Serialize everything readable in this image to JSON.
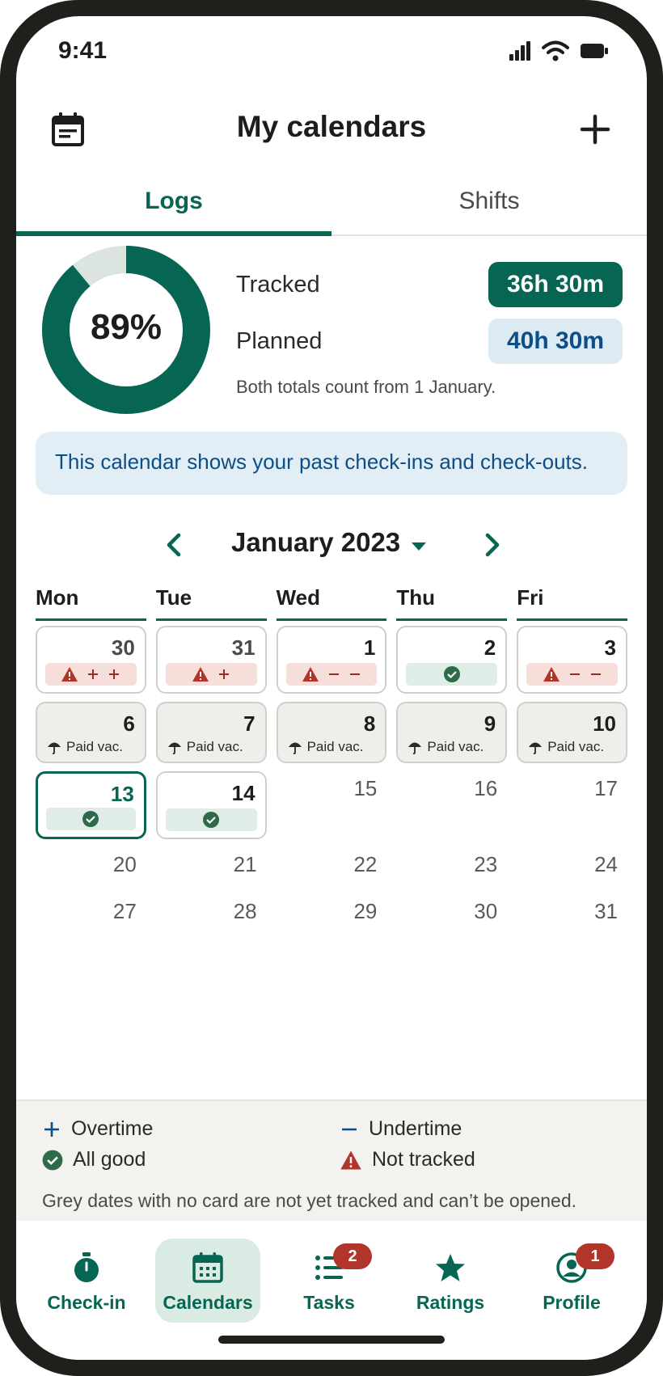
{
  "status": {
    "time": "9:41"
  },
  "header": {
    "title": "My calendars"
  },
  "tabs": [
    {
      "label": "Logs"
    },
    {
      "label": "Shifts"
    }
  ],
  "summary": {
    "percent": "89%",
    "percent_value": 0.89,
    "tracked_label": "Tracked",
    "tracked_value": "36h 30m",
    "planned_label": "Planned",
    "planned_value": "40h 30m",
    "note": "Both totals count from 1 January."
  },
  "info_banner": "This calendar shows your past check-ins and check-outs.",
  "month": {
    "label": "January 2023"
  },
  "weekdays": [
    "Mon",
    "Tue",
    "Wed",
    "Thu",
    "Fri"
  ],
  "days": {
    "d30a": "30",
    "d31a": "31",
    "d1": "1",
    "d2": "2",
    "d3": "3",
    "d6": "6",
    "d7": "7",
    "d8": "8",
    "d9": "9",
    "d10": "10",
    "d13": "13",
    "d14": "14",
    "d15": "15",
    "d16": "16",
    "d17": "17",
    "d20": "20",
    "d21": "21",
    "d22": "22",
    "d23": "23",
    "d24": "24",
    "d27": "27",
    "d28": "28",
    "d29": "29",
    "d30b": "30",
    "d31b": "31"
  },
  "vacation_label": "Paid vac.",
  "legend": {
    "overtime": "Overtime",
    "undertime": "Undertime",
    "all_good": "All good",
    "not_tracked": "Not tracked",
    "note": "Grey dates with no card are not yet tracked and can’t be opened."
  },
  "nav": {
    "checkin": "Check-in",
    "calendars": "Calendars",
    "tasks": "Tasks",
    "tasks_badge": "2",
    "ratings": "Ratings",
    "profile": "Profile",
    "profile_badge": "1"
  },
  "colors": {
    "primary": "#066653",
    "alert": "#b2352b",
    "info": "#0d4e86"
  }
}
